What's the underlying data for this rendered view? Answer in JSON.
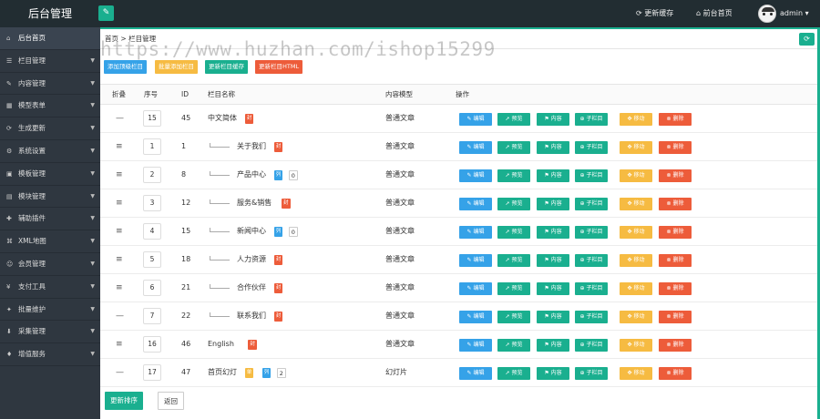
{
  "app": {
    "title": "后台管理"
  },
  "topbar": {
    "update_cache": "更新缓存",
    "front_home": "前台首页",
    "user": "admin"
  },
  "sidebar": {
    "items": [
      {
        "label": "后台首页",
        "icon": "home-icon",
        "active": true
      },
      {
        "label": "栏目管理",
        "icon": "list-icon",
        "active": false
      },
      {
        "label": "内容管理",
        "icon": "edit-icon",
        "active": false
      },
      {
        "label": "模型表单",
        "icon": "table-icon",
        "active": false
      },
      {
        "label": "生成更新",
        "icon": "refresh-icon",
        "active": false
      },
      {
        "label": "系统设置",
        "icon": "gear-icon",
        "active": false
      },
      {
        "label": "模板管理",
        "icon": "template-icon",
        "active": false
      },
      {
        "label": "模块管理",
        "icon": "module-icon",
        "active": false
      },
      {
        "label": "辅助插件",
        "icon": "plugin-icon",
        "active": false
      },
      {
        "label": "XML地图",
        "icon": "sitemap-icon",
        "active": false
      },
      {
        "label": "会员管理",
        "icon": "user-icon",
        "active": false
      },
      {
        "label": "支付工具",
        "icon": "pay-icon",
        "active": false
      },
      {
        "label": "批量维护",
        "icon": "wrench-icon",
        "active": false
      },
      {
        "label": "采集管理",
        "icon": "collect-icon",
        "active": false
      },
      {
        "label": "增值服务",
        "icon": "service-icon",
        "active": false
      }
    ]
  },
  "breadcrumb": {
    "home": "首页",
    "sep": ">",
    "current": "栏目管理"
  },
  "watermark": "https://www.huzhan.com/ishop15299",
  "toolbar": {
    "add_top": "添加顶级栏目",
    "batch_add": "批量添加栏目",
    "update_cache": "更新栏目缓存",
    "update_html": "更新栏目HTML"
  },
  "colors": {
    "green": "#1aaf8f",
    "blue": "#35a2e8",
    "orange": "#f0ad4e",
    "red": "#ed5c3a",
    "teal": "#1aaf8f",
    "yellow": "#f6bb42"
  },
  "table": {
    "headers": {
      "fold": "折叠",
      "seq": "序号",
      "id": "ID",
      "name": "栏目名称",
      "model": "内容模型",
      "ops": "操作"
    },
    "actions": {
      "edit": "编辑",
      "preview": "预览",
      "content": "内容",
      "sub": "子栏目",
      "move": "移动",
      "delete": "删除"
    },
    "rows": [
      {
        "fold": "—",
        "seq": "15",
        "id": "45",
        "name": "中文简体",
        "level": 0,
        "tag": "封",
        "tag_color": "red",
        "count": "",
        "model": "普通文章"
      },
      {
        "fold": "≡",
        "seq": "1",
        "id": "1",
        "name": "关于我们",
        "level": 1,
        "tag": "封",
        "tag_color": "red",
        "count": "",
        "model": "普通文章"
      },
      {
        "fold": "≡",
        "seq": "2",
        "id": "8",
        "name": "产品中心",
        "level": 1,
        "tag": "列",
        "tag_color": "blue",
        "count": "0",
        "model": "普通文章"
      },
      {
        "fold": "≡",
        "seq": "3",
        "id": "12",
        "name": "服务&销售",
        "level": 1,
        "tag": "封",
        "tag_color": "red",
        "count": "",
        "model": "普通文章"
      },
      {
        "fold": "≡",
        "seq": "4",
        "id": "15",
        "name": "新闻中心",
        "level": 1,
        "tag": "列",
        "tag_color": "blue",
        "count": "0",
        "model": "普通文章"
      },
      {
        "fold": "≡",
        "seq": "5",
        "id": "18",
        "name": "人力资源",
        "level": 1,
        "tag": "封",
        "tag_color": "red",
        "count": "",
        "model": "普通文章"
      },
      {
        "fold": "≡",
        "seq": "6",
        "id": "21",
        "name": "合作伙伴",
        "level": 1,
        "tag": "封",
        "tag_color": "red",
        "count": "",
        "model": "普通文章"
      },
      {
        "fold": "—",
        "seq": "7",
        "id": "22",
        "name": "联系我们",
        "level": 1,
        "tag": "封",
        "tag_color": "red",
        "count": "",
        "model": "普通文章"
      },
      {
        "fold": "≡",
        "seq": "16",
        "id": "46",
        "name": "English",
        "level": 0,
        "tag": "封",
        "tag_color": "red",
        "count": "",
        "model": "普通文章"
      },
      {
        "fold": "—",
        "seq": "17",
        "id": "47",
        "name": "首页幻灯",
        "level": 0,
        "tag": "单",
        "tag_color": "yellow",
        "tag2": "列",
        "count": "2",
        "model": "幻灯片"
      }
    ]
  },
  "footer": {
    "update_sort": "更新排序",
    "back": "返回"
  }
}
